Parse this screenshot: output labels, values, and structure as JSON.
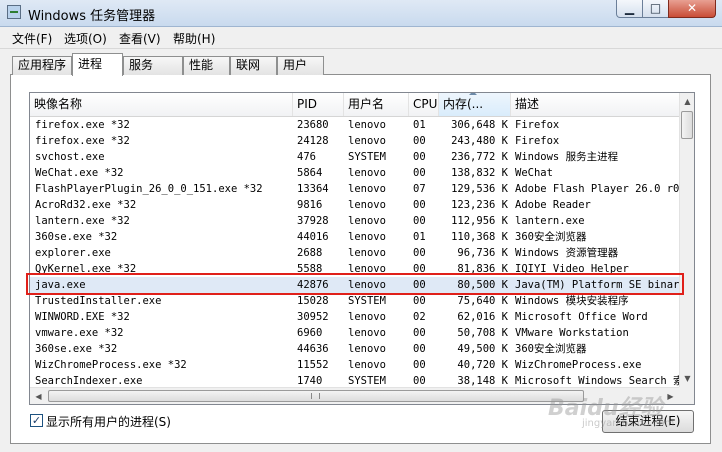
{
  "window": {
    "title": "Windows 任务管理器",
    "minimize": "▁",
    "maximize": "□",
    "close": "✕"
  },
  "menu": [
    "文件(F)",
    "选项(O)",
    "查看(V)",
    "帮助(H)"
  ],
  "tabs": [
    "应用程序",
    "进程",
    "服务",
    "性能",
    "联网",
    "用户"
  ],
  "active_tab": "进程",
  "columns": {
    "name": "映像名称",
    "pid": "PID",
    "user": "用户名",
    "cpu": "CPU",
    "memory": "内存(...",
    "description": "描述"
  },
  "processes": [
    {
      "name": "firefox.exe *32",
      "pid": "23680",
      "user": "lenovo",
      "cpu": "01",
      "memory": "306,648 K",
      "description": "Firefox"
    },
    {
      "name": "firefox.exe *32",
      "pid": "24128",
      "user": "lenovo",
      "cpu": "00",
      "memory": "243,480 K",
      "description": "Firefox"
    },
    {
      "name": "svchost.exe",
      "pid": "476",
      "user": "SYSTEM",
      "cpu": "00",
      "memory": "236,772 K",
      "description": "Windows 服务主进程"
    },
    {
      "name": "WeChat.exe *32",
      "pid": "5864",
      "user": "lenovo",
      "cpu": "00",
      "memory": "138,832 K",
      "description": "WeChat"
    },
    {
      "name": "FlashPlayerPlugin_26_0_0_151.exe *32",
      "pid": "13364",
      "user": "lenovo",
      "cpu": "07",
      "memory": "129,536 K",
      "description": "Adobe Flash Player 26.0 r0"
    },
    {
      "name": "AcroRd32.exe *32",
      "pid": "9816",
      "user": "lenovo",
      "cpu": "00",
      "memory": "123,236 K",
      "description": "Adobe Reader"
    },
    {
      "name": "lantern.exe *32",
      "pid": "37928",
      "user": "lenovo",
      "cpu": "00",
      "memory": "112,956 K",
      "description": "lantern.exe"
    },
    {
      "name": "360se.exe *32",
      "pid": "44016",
      "user": "lenovo",
      "cpu": "01",
      "memory": "110,368 K",
      "description": "360安全浏览器"
    },
    {
      "name": "explorer.exe",
      "pid": "2688",
      "user": "lenovo",
      "cpu": "00",
      "memory": "96,736 K",
      "description": "Windows 资源管理器"
    },
    {
      "name": "QyKernel.exe *32",
      "pid": "5588",
      "user": "lenovo",
      "cpu": "00",
      "memory": "81,836 K",
      "description": "IQIYI Video Helper"
    },
    {
      "name": "java.exe",
      "pid": "42876",
      "user": "lenovo",
      "cpu": "00",
      "memory": "80,500 K",
      "description": "Java(TM) Platform SE binary"
    },
    {
      "name": "TrustedInstaller.exe",
      "pid": "15028",
      "user": "SYSTEM",
      "cpu": "00",
      "memory": "75,640 K",
      "description": "Windows 模块安装程序"
    },
    {
      "name": "WINWORD.EXE *32",
      "pid": "30952",
      "user": "lenovo",
      "cpu": "02",
      "memory": "62,016 K",
      "description": "Microsoft Office Word"
    },
    {
      "name": "vmware.exe *32",
      "pid": "6960",
      "user": "lenovo",
      "cpu": "00",
      "memory": "50,708 K",
      "description": "VMware Workstation"
    },
    {
      "name": "360se.exe *32",
      "pid": "44636",
      "user": "lenovo",
      "cpu": "00",
      "memory": "49,500 K",
      "description": "360安全浏览器"
    },
    {
      "name": "WizChromeProcess.exe *32",
      "pid": "11552",
      "user": "lenovo",
      "cpu": "00",
      "memory": "40,720 K",
      "description": "WizChromeProcess.exe"
    },
    {
      "name": "SearchIndexer.exe",
      "pid": "1740",
      "user": "SYSTEM",
      "cpu": "00",
      "memory": "38,148 K",
      "description": "Microsoft Windows Search 索"
    }
  ],
  "selected_row_index": 10,
  "show_all_users": {
    "checked": true,
    "label": "显示所有用户的进程(S)"
  },
  "end_process_button": "结束进程(E)",
  "watermark": {
    "text": "Baidu经验",
    "sub": "jingyan.baidu.com"
  },
  "colors": {
    "highlight_border": "#e0201a",
    "selected_row": "#dfe9f6"
  }
}
